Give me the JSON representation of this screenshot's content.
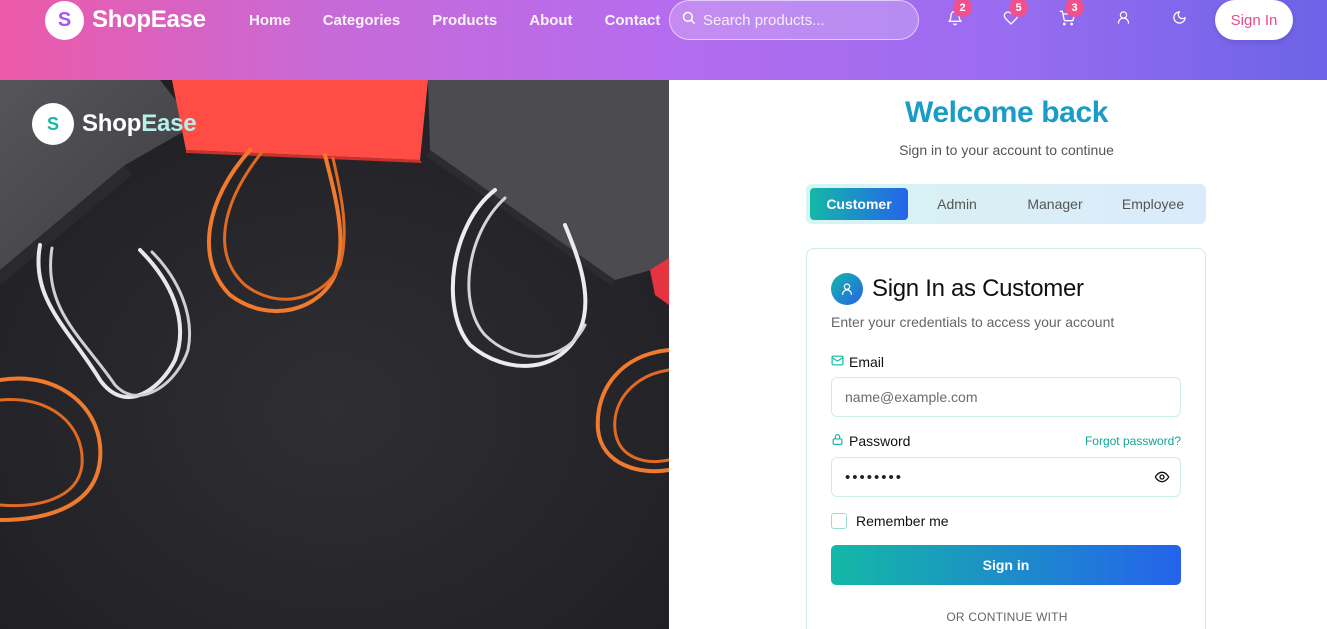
{
  "header": {
    "brand_initial": "S",
    "brand_name": "ShopEase",
    "nav": [
      "Home",
      "Categories",
      "Products",
      "About",
      "Contact"
    ],
    "search_placeholder": "Search products...",
    "icons": [
      {
        "name": "bell-icon",
        "badge": "2"
      },
      {
        "name": "heart-icon",
        "badge": "5"
      },
      {
        "name": "cart-icon",
        "badge": "3"
      },
      {
        "name": "user-icon",
        "badge": ""
      },
      {
        "name": "moon-icon",
        "badge": ""
      }
    ],
    "sign_in": "Sign In"
  },
  "hero": {
    "brand_initial": "S",
    "brand_name_main": "Shop",
    "brand_name_accent": "Ease"
  },
  "login": {
    "title": "Welcome back",
    "subtitle": "Sign in to your account to continue",
    "roles": [
      "Customer",
      "Admin",
      "Manager",
      "Employee"
    ],
    "active_role": "Customer",
    "card_title": "Sign In as Customer",
    "card_desc": "Enter your credentials to access your account",
    "email_label": "Email",
    "email_placeholder": "name@example.com",
    "password_label": "Password",
    "forgot": "Forgot password?",
    "password_value": "••••••••",
    "remember": "Remember me",
    "submit": "Sign in",
    "or_continue": "OR CONTINUE WITH"
  },
  "colors": {
    "accent_teal": "#14b8a6",
    "accent_blue": "#2563eb",
    "welcome": "#1a9cc9",
    "badge": "#f0508c"
  }
}
